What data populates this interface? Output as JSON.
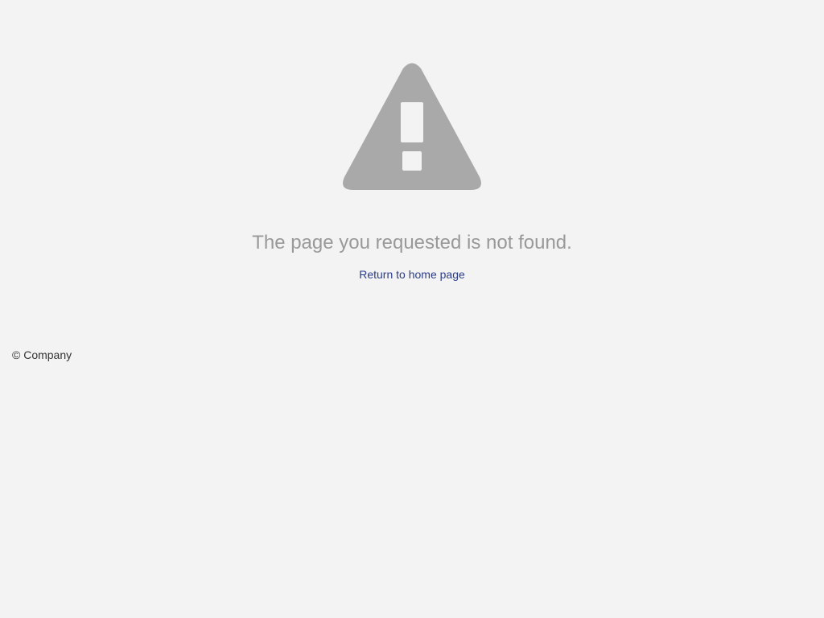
{
  "error": {
    "icon": "warning-triangle-icon",
    "icon_color": "#a9a9a9",
    "message": "The page you requested is not found.",
    "home_link_label": "Return to home page"
  },
  "footer": {
    "copyright": "© Company"
  },
  "colors": {
    "background": "#f3f3f3",
    "message_text": "#999999",
    "link": "#2b3c87",
    "footer_text": "#333333"
  }
}
